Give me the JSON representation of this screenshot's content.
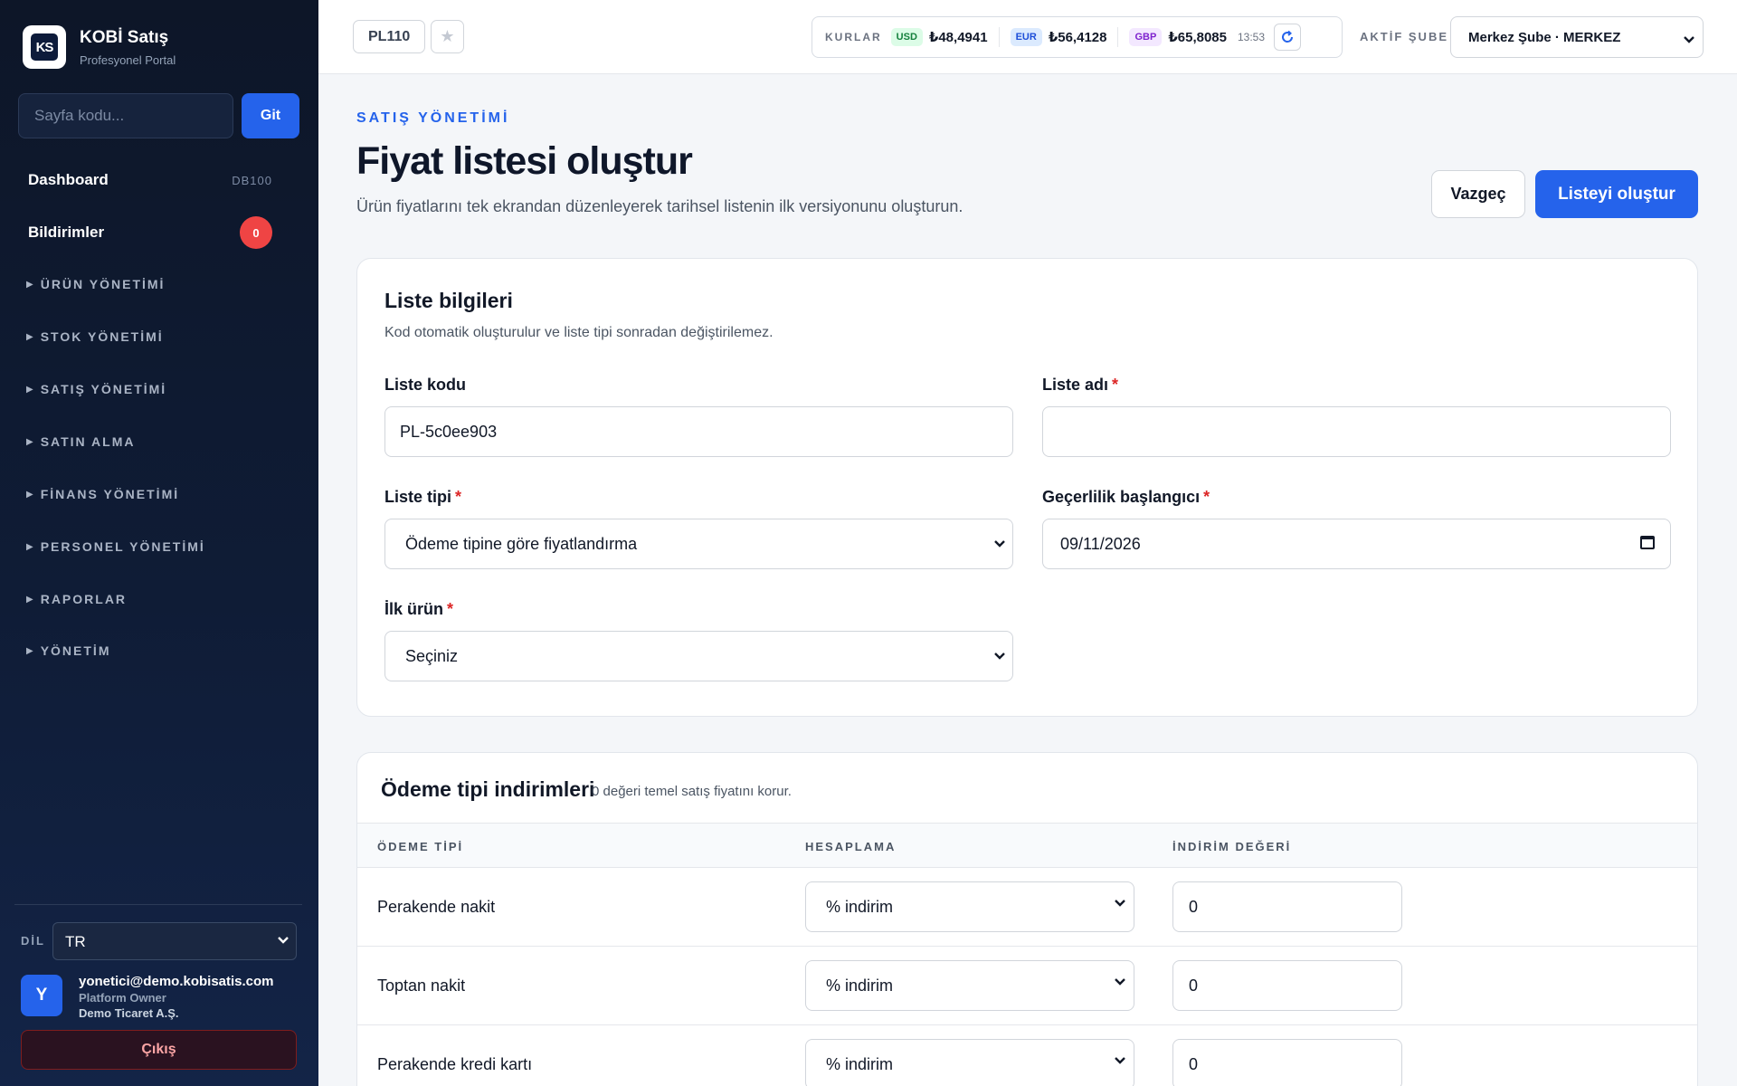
{
  "sidebar": {
    "brand_title": "KOBİ Satış",
    "brand_sub": "Profesyonel Portal",
    "logo_text": "KS",
    "page_code_placeholder": "Sayfa kodu...",
    "go_label": "Git",
    "dashboard_label": "Dashboard",
    "dashboard_code": "DB100",
    "notifications_label": "Bildirimler",
    "notifications_count": "0",
    "sections": [
      "ÜRÜN YÖNETİMİ",
      "STOK YÖNETİMİ",
      "SATIŞ YÖNETİMİ",
      "SATIN ALMA",
      "FİNANS YÖNETİMİ",
      "PERSONEL YÖNETİMİ",
      "RAPORLAR",
      "YÖNETİM"
    ],
    "lang_label": "DİL",
    "lang_value": "TR",
    "user_initial": "Y",
    "user_email": "yonetici@demo.kobisatis.com",
    "user_role": "Platform Owner",
    "user_company": "Demo Ticaret A.Ş.",
    "logout_label": "Çıkış"
  },
  "topbar": {
    "page_code": "PL110",
    "rates_label": "KURLAR",
    "usd_tag": "USD",
    "usd_value": "₺48,4941",
    "eur_tag": "EUR",
    "eur_value": "₺56,4128",
    "gbp_tag": "GBP",
    "gbp_value": "₺65,8085",
    "rates_time": "13:53",
    "branch_label": "AKTİF ŞUBE",
    "branch_value": "Merkez Şube · MERKEZ"
  },
  "header": {
    "eyebrow": "SATIŞ YÖNETİMİ",
    "title": "Fiyat listesi oluştur",
    "description": "Ürün fiyatlarını tek ekrandan düzenleyerek tarihsel listenin ilk versiyonunu oluşturun.",
    "cancel_label": "Vazgeç",
    "create_label": "Listeyi oluştur"
  },
  "list_info": {
    "title": "Liste bilgileri",
    "subtitle": "Kod otomatik oluşturulur ve liste tipi sonradan değiştirilemez.",
    "code_label": "Liste kodu",
    "code_value": "PL-5c0ee903",
    "name_label": "Liste adı",
    "name_value": "",
    "type_label": "Liste tipi",
    "type_value": "Ödeme tipine göre fiyatlandırma",
    "start_label": "Geçerlilik başlangıcı",
    "start_value": "09/11/2026",
    "first_product_label": "İlk ürün",
    "first_product_value": "Seçiniz"
  },
  "discounts": {
    "title": "Ödeme tipi indirimleri",
    "hint": "0 değeri temel satış fiyatını korur.",
    "col_payment": "ÖDEME TİPİ",
    "col_calc": "HESAPLAMA",
    "col_value": "İNDİRİM DEĞERİ",
    "rows": [
      {
        "name": "Perakende nakit",
        "calc": "% indirim",
        "value": "0"
      },
      {
        "name": "Toptan nakit",
        "calc": "% indirim",
        "value": "0"
      },
      {
        "name": "Perakende kredi kartı",
        "calc": "% indirim",
        "value": "0"
      }
    ]
  }
}
